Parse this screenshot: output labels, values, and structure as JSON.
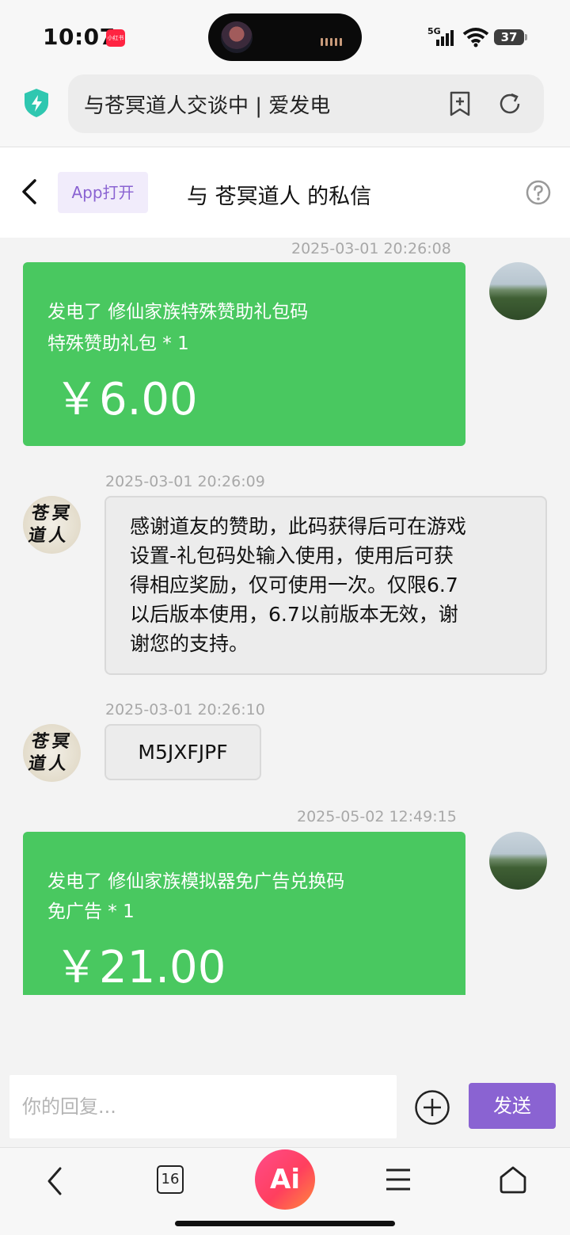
{
  "status_bar": {
    "time": "10:07",
    "app_badge": "小红书",
    "network": "5G",
    "battery": "37"
  },
  "browser": {
    "address_title": "与苍冥道人交谈中 | 爱发电"
  },
  "header": {
    "app_open_label": "App打开",
    "title": "与 苍冥道人 的私信"
  },
  "messages": [
    {
      "timestamp": "2025-03-01 20:26:08",
      "line1": "发电了 修仙家族特殊赞助礼包码",
      "line2": "特殊赞助礼包 * 1",
      "price": "￥6.00"
    },
    {
      "timestamp": "2025-03-01 20:26:09",
      "text_lines": [
        "感谢道友的赞助，此码获得后可在游戏",
        "设置-礼包码处输入使用，使用后可获",
        "得相应奖励，仅可使用一次。仅限6.7",
        "以后版本使用，6.7以前版本无效，谢",
        "谢您的支持。"
      ]
    },
    {
      "timestamp": "2025-03-01 20:26:10",
      "text": "M5JXFJPF"
    },
    {
      "timestamp": "2025-05-02 12:49:15",
      "line1": "发电了 修仙家族模拟器免广告兑换码",
      "line2": "免广告 * 1",
      "price": "￥21.00"
    }
  ],
  "composer": {
    "placeholder": "你的回复...",
    "send_label": "发送"
  },
  "nav": {
    "tab_count": "16",
    "ai_label": "Ai"
  },
  "colors": {
    "accent": "#8a63d2",
    "card_green": "#49c860"
  }
}
